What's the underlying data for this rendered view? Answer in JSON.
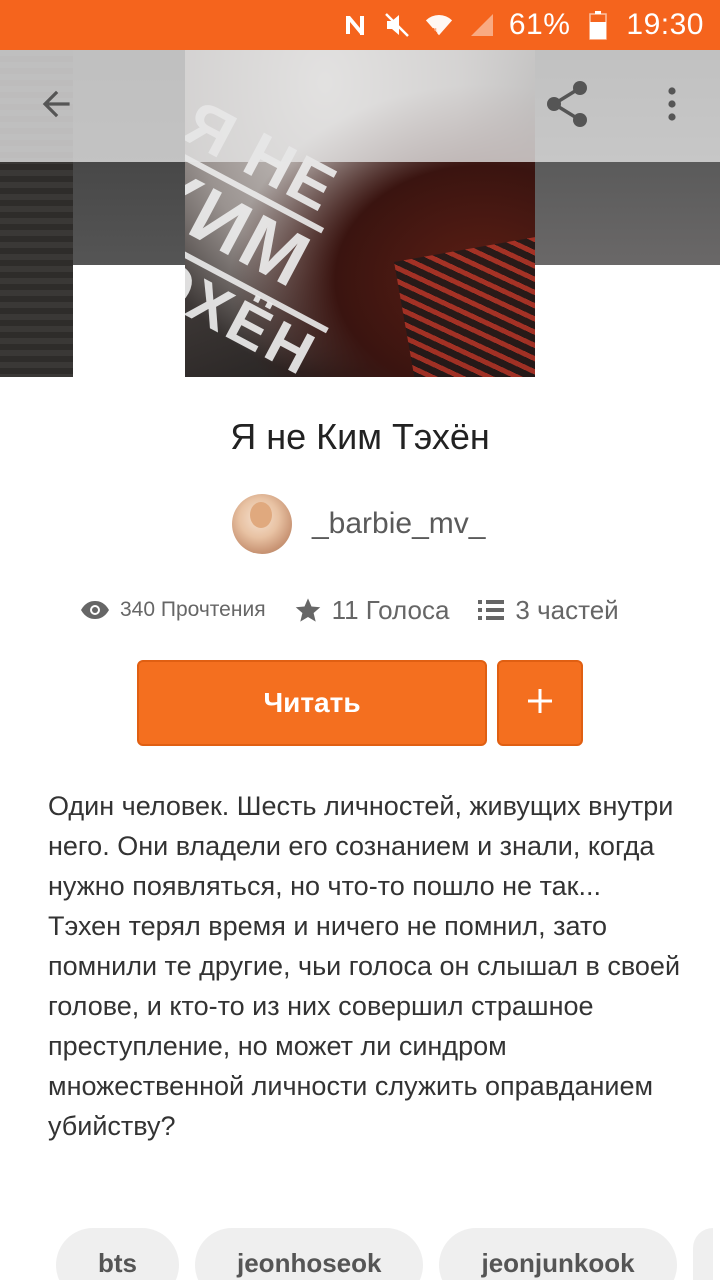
{
  "status_bar": {
    "battery_percent": "61%",
    "time": "19:30",
    "icons": [
      "nfc-icon",
      "mute-icon",
      "wifi-icon",
      "signal-icon",
      "battery-icon"
    ]
  },
  "toolbar": {
    "icons": [
      "back-arrow-icon",
      "share-icon",
      "more-vert-icon"
    ]
  },
  "cover": {
    "lines": [
      "Я НЕ",
      "КИМ",
      "ТЭХЁН"
    ]
  },
  "story": {
    "title": "Я не Ким Тэхён",
    "author": "_barbie_mv_",
    "stats": {
      "reads": "340 Прочтения",
      "votes": "11 Голоса",
      "parts": "3 частей"
    },
    "read_button": "Читать",
    "add_button": "+",
    "description": [
      "Один человек. Шесть личностей, живущих внутри него. Они владели его сознанием и знали, когда нужно появляться, но что-то пошло не так...",
      "Тэхен терял время и ничего не помнил, зато помнили те другие, чьи голоса он слышал в своей голове, и кто-то из них совершил страшное преступление, но может ли синдром множественной личности служить оправданием убийству?"
    ],
    "tags": [
      "bts",
      "jeonhoseok",
      "jeonjunkook"
    ]
  },
  "colors": {
    "accent": "#f46f1f",
    "status_bar": "#f5641d"
  }
}
